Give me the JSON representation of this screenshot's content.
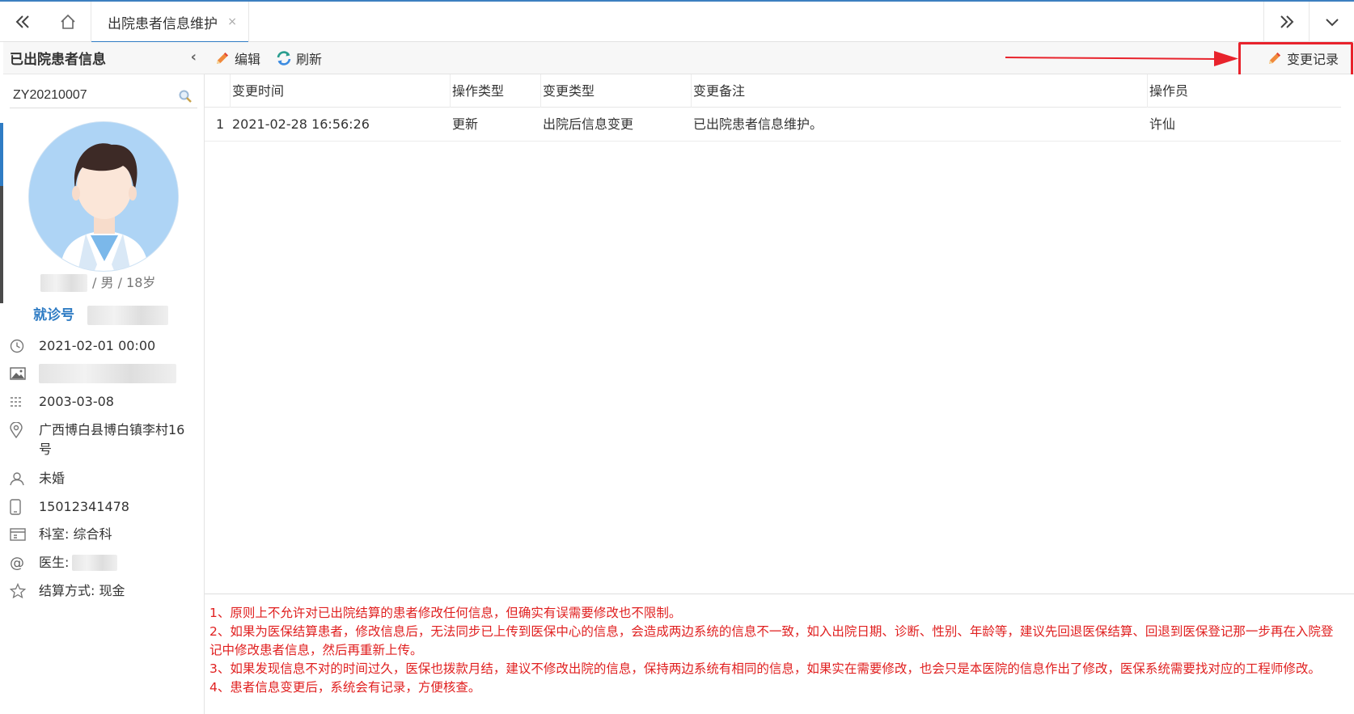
{
  "topbar": {
    "tab_title": "出院患者信息维护",
    "tab_close": "×"
  },
  "sidebar": {
    "title": "已出院患者信息",
    "collapse_glyph": "‹",
    "search_value": "ZY20210007",
    "patient_line_suffix": "/ 男 / 18岁",
    "visit_no_label": "就诊号",
    "admit_time": "2021-02-01 00:00",
    "birth_date": "2003-03-08",
    "address": "广西博白县博白镇李村16号",
    "marital": "未婚",
    "phone": "15012341478",
    "department": "科室: 综合科",
    "doctor_label": "医生:",
    "settlement": "结算方式: 现金"
  },
  "toolbar": {
    "edit_label": "编辑",
    "refresh_label": "刷新",
    "history_label": "变更记录"
  },
  "grid": {
    "columns": [
      "变更时间",
      "操作类型",
      "变更类型",
      "变更备注",
      "操作员"
    ],
    "rows": [
      {
        "index": "1",
        "time": "2021-02-28 16:56:26",
        "op_type": "更新",
        "change_type": "出院后信息变更",
        "remark": "已出院患者信息维护。",
        "operator": "许仙"
      }
    ]
  },
  "notes": [
    "1、原则上不允许对已出院结算的患者修改任何信息，但确实有误需要修改也不限制。",
    "2、如果为医保结算患者，修改信息后，无法同步已上传到医保中心的信息，会造成两边系统的信息不一致，如入出院日期、诊断、性别、年龄等，建议先回退医保结算、回退到医保登记那一步再在入院登记中修改患者信息，然后再重新上传。",
    "3、如果发现信息不对的时间过久，医保也拨款月结，建议不修改出院的信息，保持两边系统有相同的信息，如果实在需要修改，也会只是本医院的信息作出了修改，医保系统需要找对应的工程师修改。",
    "4、患者信息变更后，系统会有记录，方便核查。"
  ],
  "colors": {
    "accent": "#2f7cc4",
    "warning_text": "#e02020",
    "annotation": "#e8232c"
  }
}
